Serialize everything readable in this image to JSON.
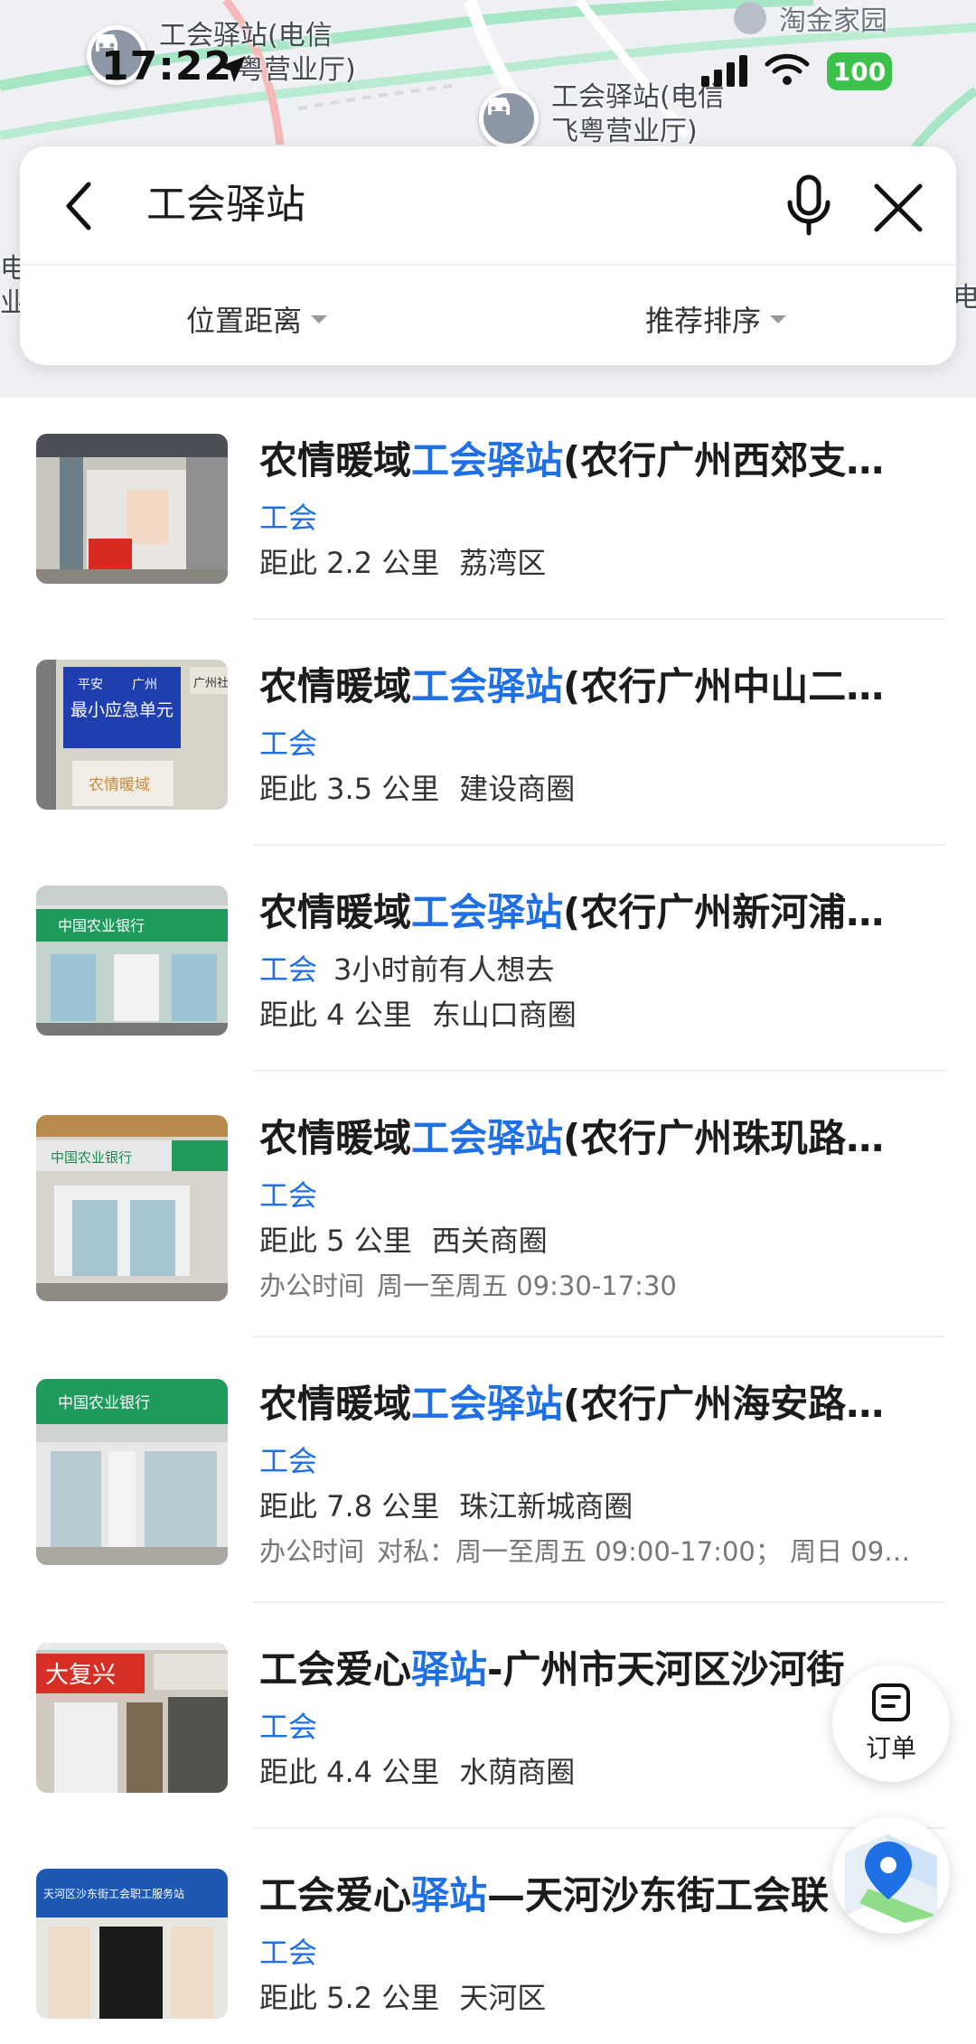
{
  "status_bar": {
    "time": "17:22",
    "battery": "100"
  },
  "map": {
    "labels": [
      "工会驿站(电信",
      "粤营业厅)",
      "淘金家园",
      "工会驿站(电信",
      "飞粤营业厅)",
      "电",
      "业",
      "电"
    ]
  },
  "search": {
    "query": "工会驿站",
    "filters": [
      "位置距离",
      "推荐排序"
    ]
  },
  "results": [
    {
      "title_prefix": "农情暖域",
      "title_highlight": "工会驿站",
      "title_suffix": "(农行广州西郊支…",
      "category": "工会",
      "extra": "",
      "distance": "距此 2.2 公里",
      "area": "荔湾区",
      "hours_label": "",
      "hours": ""
    },
    {
      "title_prefix": "农情暖域",
      "title_highlight": "工会驿站",
      "title_suffix": "(农行广州中山二…",
      "category": "工会",
      "extra": "",
      "distance": "距此 3.5 公里",
      "area": "建设商圈",
      "hours_label": "",
      "hours": ""
    },
    {
      "title_prefix": "农情暖域",
      "title_highlight": "工会驿站",
      "title_suffix": "(农行广州新河浦…",
      "category": "工会",
      "extra": "3小时前有人想去",
      "distance": "距此 4 公里",
      "area": "东山口商圈",
      "hours_label": "",
      "hours": ""
    },
    {
      "title_prefix": "农情暖域",
      "title_highlight": "工会驿站",
      "title_suffix": "(农行广州珠玑路…",
      "category": "工会",
      "extra": "",
      "distance": "距此 5 公里",
      "area": "西关商圈",
      "hours_label": "办公时间",
      "hours": "周一至周五 09:30-17:30"
    },
    {
      "title_prefix": "农情暖域",
      "title_highlight": "工会驿站",
      "title_suffix": "(农行广州海安路…",
      "category": "工会",
      "extra": "",
      "distance": "距此 7.8 公里",
      "area": "珠江新城商圈",
      "hours_label": "办公时间",
      "hours": "对私：周一至周五 09:00-17:00； 周日 09…"
    },
    {
      "title_prefix": "工会爱心",
      "title_highlight": "驿站",
      "title_suffix": "-广州市天河区沙河街",
      "category": "工会",
      "extra": "",
      "distance": "距此 4.4 公里",
      "area": "水荫商圈",
      "hours_label": "",
      "hours": ""
    },
    {
      "title_prefix": "工会爱心",
      "title_highlight": "驿站",
      "title_suffix": "—天河沙东街工会联",
      "category": "工会",
      "extra": "",
      "distance": "距此 5.2 公里",
      "area": "天河区",
      "hours_label": "",
      "hours": ""
    }
  ],
  "thumbnails": [
    {
      "sign_lines": []
    },
    {
      "sign_lines": [
        "平安",
        "广州",
        "最小应急单元",
        "农情暖域",
        "广州社"
      ]
    },
    {
      "sign_lines": [
        "中国农业银行"
      ]
    },
    {
      "sign_lines": [
        "中国农业银行"
      ]
    },
    {
      "sign_lines": [
        "中国农业银行"
      ]
    },
    {
      "sign_lines": [
        "大复兴"
      ]
    },
    {
      "sign_lines": [
        "天河区沙东街工会职工服务站"
      ]
    }
  ],
  "floating": {
    "order_label": "订单"
  },
  "colors": {
    "accent": "#1f6fe5",
    "battery": "#3cc24a"
  }
}
